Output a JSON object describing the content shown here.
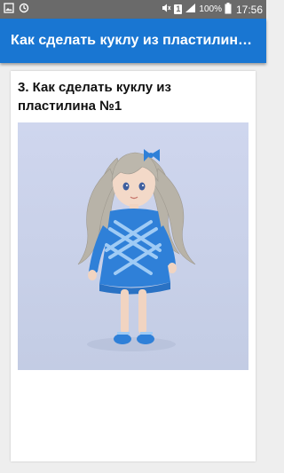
{
  "status_bar": {
    "sim_slot": "1",
    "battery_percent": "100%",
    "time": "17:56",
    "icons": [
      "gallery-icon",
      "sync-icon",
      "mute-icon",
      "sim-icon",
      "signal-icon",
      "battery-icon"
    ]
  },
  "app_bar": {
    "title": "Как сделать куклу из пластилин…"
  },
  "article": {
    "title": "3. Как сделать куклу из пластилина №1",
    "image_description_name": "doll-image"
  },
  "colors": {
    "app_bar": "#1976d2",
    "status_bar": "#6a6a6a",
    "dress": "#2f80d8",
    "photo_background": "#c9d1e8"
  }
}
